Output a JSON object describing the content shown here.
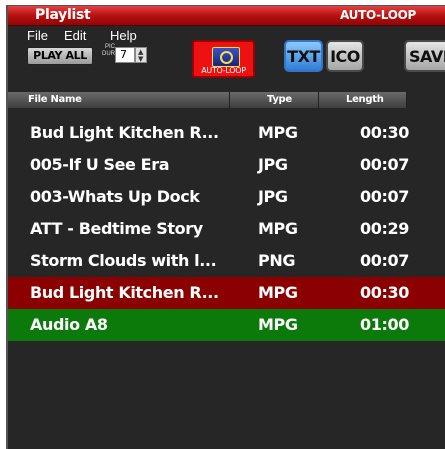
{
  "window": {
    "title": "Playlist",
    "mode_label": "AUTO-LOOP"
  },
  "menu": {
    "file": "File",
    "edit": "Edit",
    "help": "Help"
  },
  "toolbar": {
    "play_all_label": "PLAY ALL",
    "pic_label": "PIC",
    "dur_label": "DUR",
    "duration_value": "7",
    "autoloop_label": "AUTO-LOOP",
    "txt_label": "TXT",
    "ico_label": "ICO",
    "save_label": "SAVE"
  },
  "table": {
    "columns": [
      "File Name",
      "Type",
      "Length"
    ],
    "rows": [
      {
        "name": "Bud Light Kitchen R...",
        "type": "MPG",
        "length": "00:30",
        "state": "normal"
      },
      {
        "name": "005-If U See Era",
        "type": "JPG",
        "length": "00:07",
        "state": "normal"
      },
      {
        "name": "003-Whats Up Dock",
        "type": "JPG",
        "length": "00:07",
        "state": "normal"
      },
      {
        "name": "ATT - Bedtime Story",
        "type": "MPG",
        "length": "00:29",
        "state": "normal"
      },
      {
        "name": "Storm Clouds with l...",
        "type": "PNG",
        "length": "00:07",
        "state": "normal"
      },
      {
        "name": "Bud Light Kitchen R...",
        "type": "MPG",
        "length": "00:30",
        "state": "selected"
      },
      {
        "name": "Audio A8",
        "type": "MPG",
        "length": "01:00",
        "state": "playing"
      }
    ]
  },
  "colors": {
    "title_red": "#b81010",
    "selected_row": "#8b0000",
    "playing_row": "#0b7a0b",
    "txt_active": "#2f7fd6"
  },
  "icons": {
    "autoloop": "autoloop-icon",
    "spinner": "spinner-arrows-icon"
  }
}
